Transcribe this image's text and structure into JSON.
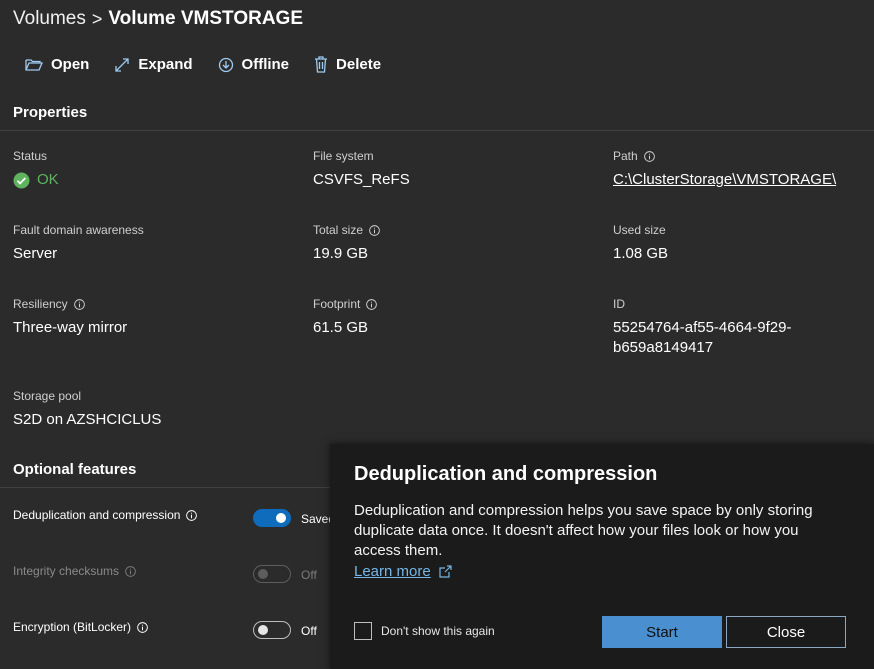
{
  "breadcrumb": {
    "parent": "Volumes",
    "separator": ">",
    "current": "Volume VMSTORAGE"
  },
  "toolbar": {
    "open": "Open",
    "expand": "Expand",
    "offline": "Offline",
    "delete": "Delete"
  },
  "properties": {
    "title": "Properties",
    "status": {
      "label": "Status",
      "value": "OK",
      "icon": "check-circle-icon",
      "color": "#5fb35f"
    },
    "file_system": {
      "label": "File system",
      "value": "CSVFS_ReFS"
    },
    "path": {
      "label": "Path",
      "value": "C:\\ClusterStorage\\VMSTORAGE\\"
    },
    "fault_domain": {
      "label": "Fault domain awareness",
      "value": "Server"
    },
    "total_size": {
      "label": "Total size",
      "value": "19.9 GB"
    },
    "used_size": {
      "label": "Used size",
      "value": "1.08 GB"
    },
    "resiliency": {
      "label": "Resiliency",
      "value": "Three-way mirror"
    },
    "footprint": {
      "label": "Footprint",
      "value": "61.5 GB"
    },
    "id": {
      "label": "ID",
      "line1": "55254764-af55-4664-9f29-",
      "line2": "b659a8149417"
    },
    "storage_pool": {
      "label": "Storage pool",
      "value": "S2D on AZSHCICLUS"
    }
  },
  "optional_features": {
    "title": "Optional features",
    "dedup": {
      "label": "Deduplication and compression",
      "state": "Saved",
      "enabled": true
    },
    "integrity": {
      "label": "Integrity checksums",
      "state": "Off",
      "enabled": false,
      "disabled": true
    },
    "encryption": {
      "label": "Encryption (BitLocker)",
      "state": "Off",
      "enabled": false
    }
  },
  "teaching_popup": {
    "title": "Deduplication and compression",
    "body": "Deduplication and compression helps you save space by only storing duplicate data once. It doesn't affect how your files look or how you access them.",
    "learn_more": "Learn more",
    "checkbox_label": "Don't show this again",
    "start": "Start",
    "close": "Close"
  },
  "colors": {
    "background": "#2b2b2b",
    "popup": "#1b1b1b",
    "accent": "#0f6cbd",
    "link": "#75b6e7",
    "primary_button": "#4a8fd0"
  }
}
